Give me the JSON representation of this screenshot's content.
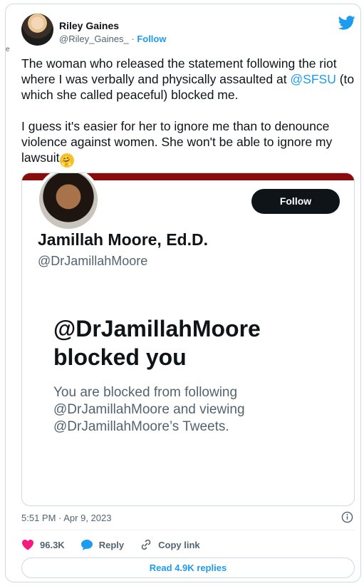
{
  "author": {
    "name": "Riley Gaines",
    "handle": "@Riley_Gaines_",
    "separator": " · ",
    "follow_label": "Follow"
  },
  "edge_mark": "e",
  "tweet": {
    "text_part1": "The woman who released the statement following the riot where I was verbally and physically assaulted at ",
    "mention": "@SFSU",
    "text_part2": " (to which she called peaceful) blocked me.\n\nI guess it's easier for her to ignore me than to denounce violence against women. She won't be able to ignore my lawsuit",
    "emoji": "🤗"
  },
  "embed": {
    "follow_label": "Follow",
    "name": "Jamillah Moore, Ed.D.",
    "handle": "@DrJamillahMoore",
    "blocked_title": "@DrJamillahMoore blocked you",
    "blocked_desc": "You are blocked from following @DrJamillahMoore and viewing @DrJamillahMoore’s Tweets."
  },
  "timestamp": "5:51 PM · Apr 9, 2023",
  "actions": {
    "like_count": "96.3K",
    "reply_label": "Reply",
    "copy_label": "Copy link"
  },
  "replies_button": "Read 4.9K replies",
  "colors": {
    "accent": "#1d9bf0",
    "like": "#f91880",
    "banner": "#8b0a0a"
  }
}
